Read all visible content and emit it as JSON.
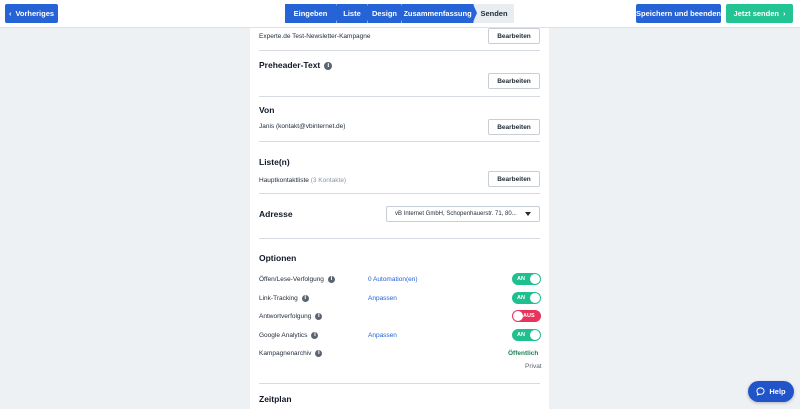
{
  "topbar": {
    "back_label": "Vorheriges",
    "back_icon": "‹",
    "steps": [
      {
        "label": "Eingeben",
        "active": true
      },
      {
        "label": "Liste",
        "active": true
      },
      {
        "label": "Design",
        "active": true
      },
      {
        "label": "Zusammenfassung",
        "active": true
      },
      {
        "label": "Senden",
        "active": false
      }
    ],
    "save_label": "Speichern und beenden",
    "send_label": "Jetzt senden",
    "send_icon": "›"
  },
  "sections": {
    "subject": {
      "value": "Experte.de Test-Newsletter-Kampagne",
      "edit_label": "Bearbeiten"
    },
    "preheader": {
      "title": "Preheader-Text",
      "edit_label": "Bearbeiten"
    },
    "from": {
      "title": "Von",
      "value": "Janis (kontakt@vbinternet.de)",
      "edit_label": "Bearbeiten"
    },
    "lists": {
      "title": "Liste(n)",
      "value": "Hauptkontaktliste",
      "count": "(3 Kontakte)",
      "edit_label": "Bearbeiten"
    },
    "address": {
      "title": "Adresse",
      "selected": "vB Internet GmbH, Schopenhauerstr. 71, 80..."
    },
    "options": {
      "title": "Optionen",
      "items": [
        {
          "label": "Öffen/Lese-Verfolgung",
          "link": "0 Automation(en)",
          "toggle": "AN",
          "on": true
        },
        {
          "label": "Link-Tracking",
          "link": "Anpassen",
          "toggle": "AN",
          "on": true
        },
        {
          "label": "Antwortverfolgung",
          "link": "",
          "toggle": "AUS",
          "on": false
        },
        {
          "label": "Google Analytics",
          "link": "Anpassen",
          "toggle": "AN",
          "on": true
        }
      ],
      "archive": {
        "label": "Kampagnenarchiv",
        "selected": "Öffentlich",
        "other": "Privat"
      }
    },
    "schedule": {
      "title": "Zeitplan"
    }
  },
  "help": {
    "label": "Help"
  },
  "colors": {
    "primary": "#2563d6",
    "success": "#22c493",
    "toggle_on": "#1fbf8f",
    "toggle_off": "#e8345b",
    "background": "#eef1f4"
  }
}
